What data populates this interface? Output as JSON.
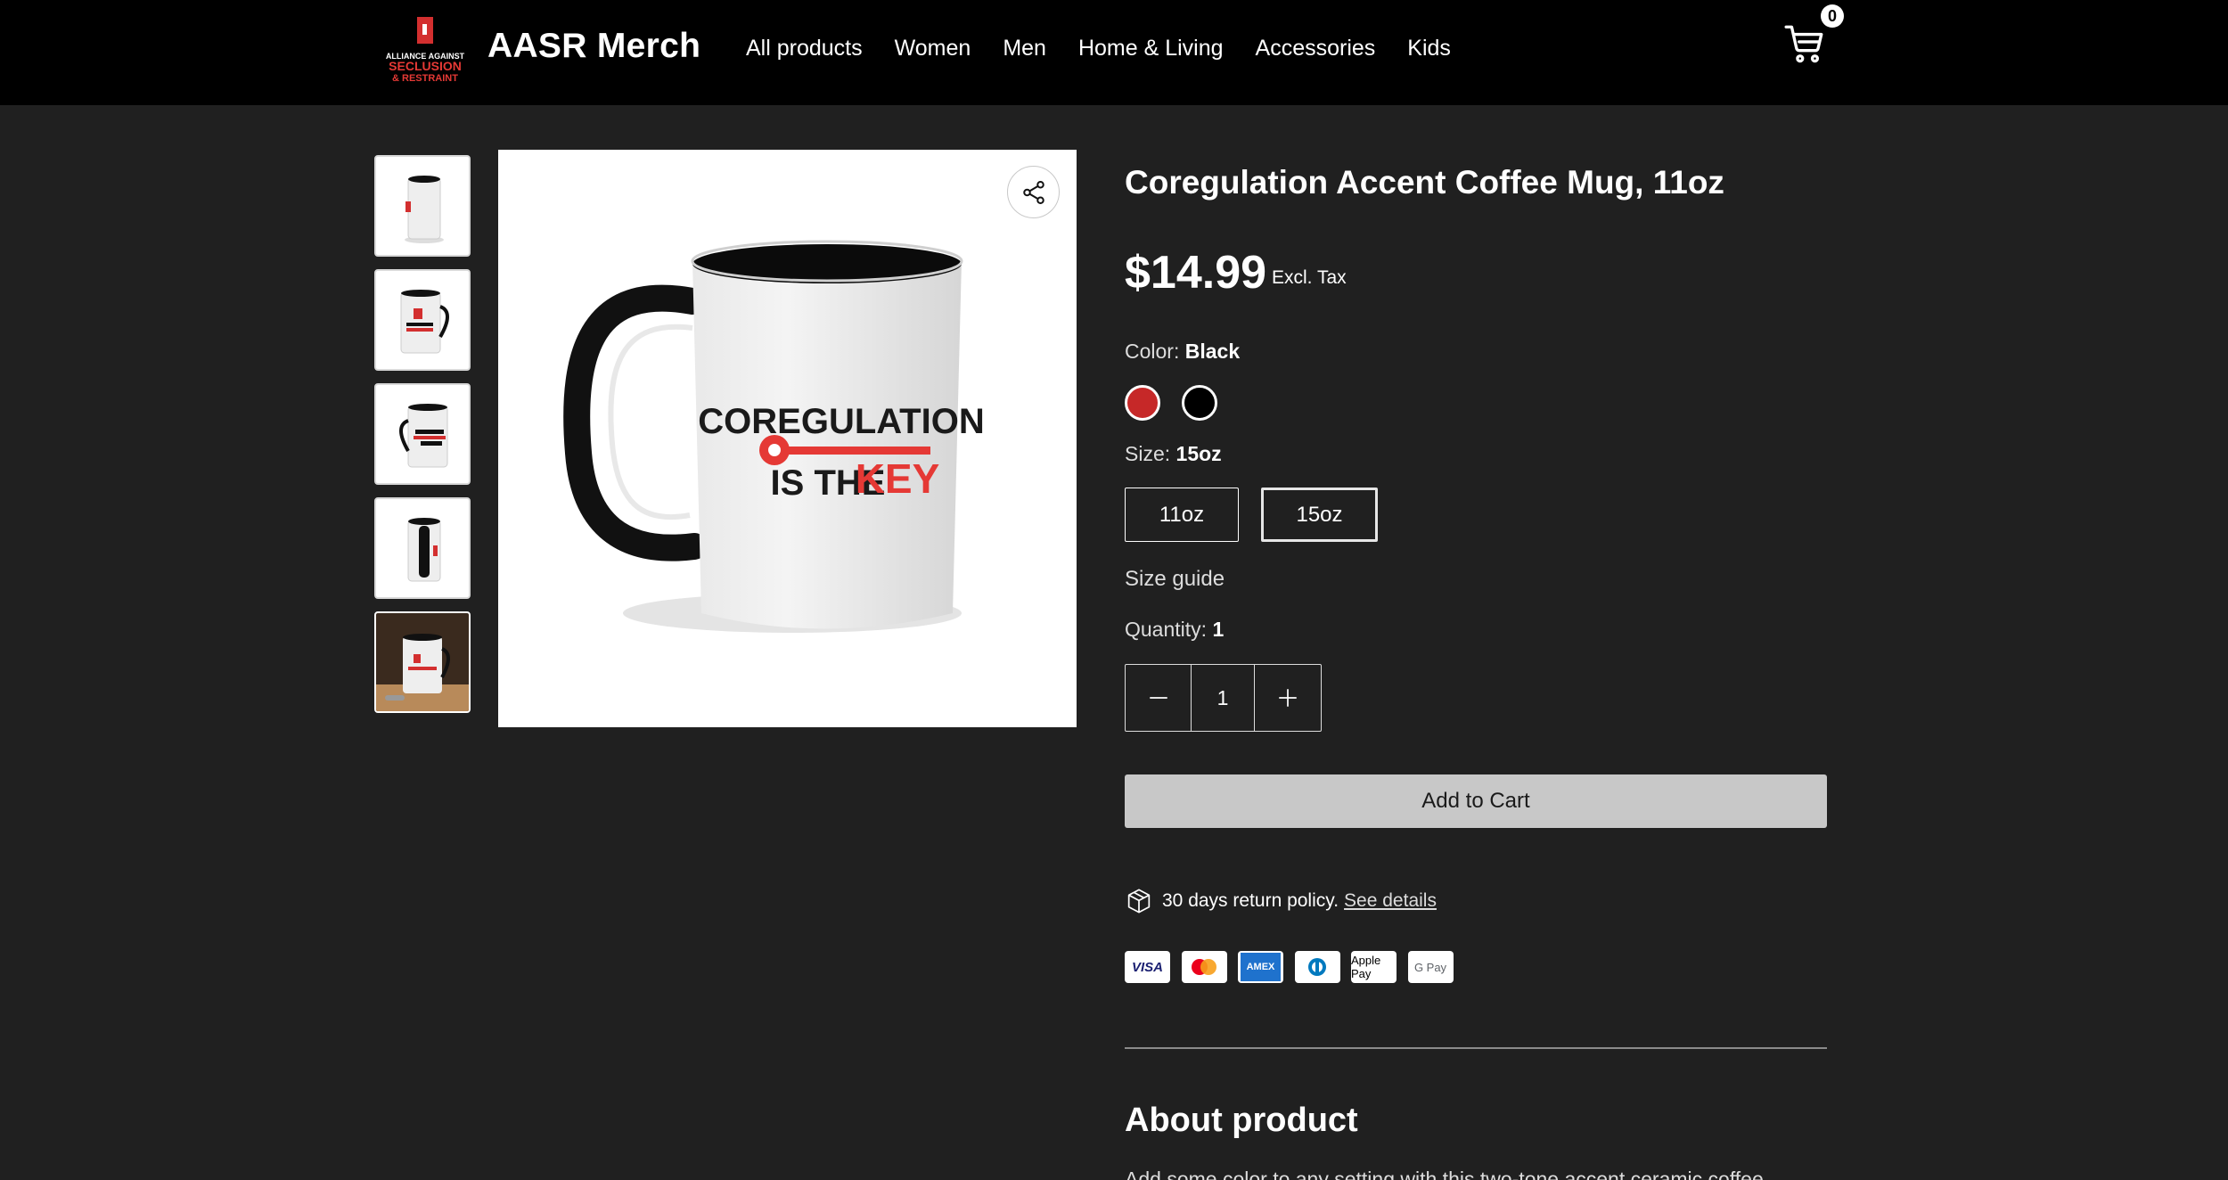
{
  "header": {
    "brand": "AASR Merch",
    "logo_text": [
      "ALLIANCE AGAINST",
      "SECLUSION",
      "& RESTRAINT"
    ],
    "nav": [
      "All products",
      "Women",
      "Men",
      "Home & Living",
      "Accessories",
      "Kids"
    ],
    "cart_count": "0"
  },
  "product": {
    "title": "Coregulation Accent Coffee Mug, 11oz",
    "price": "$14.99",
    "tax_note": "Excl. Tax",
    "mug_text_line1": "COREGULATION",
    "mug_text_line2": "IS THE",
    "mug_text_key": "KEY",
    "color_label": "Color:",
    "color_value": "Black",
    "colors": [
      "#c62828",
      "#000000"
    ],
    "size_label": "Size:",
    "size_value": "15oz",
    "sizes": [
      "11oz",
      "15oz"
    ],
    "size_guide": "Size guide",
    "quantity_label": "Quantity:",
    "quantity_value": "1",
    "add_to_cart": "Add to Cart",
    "return_text": "30 days return policy.",
    "return_link": "See details",
    "payments": [
      "VISA",
      "mastercard",
      "AMEX",
      "diners",
      "Apple Pay",
      "G Pay"
    ],
    "about_heading": "About product",
    "about_text": "Add some color to any setting with this two-tone accent ceramic coffee"
  },
  "icons": {
    "cart": "cart-icon",
    "share": "share-icon",
    "minus": "minus-icon",
    "plus": "plus-icon",
    "box": "box-icon"
  }
}
